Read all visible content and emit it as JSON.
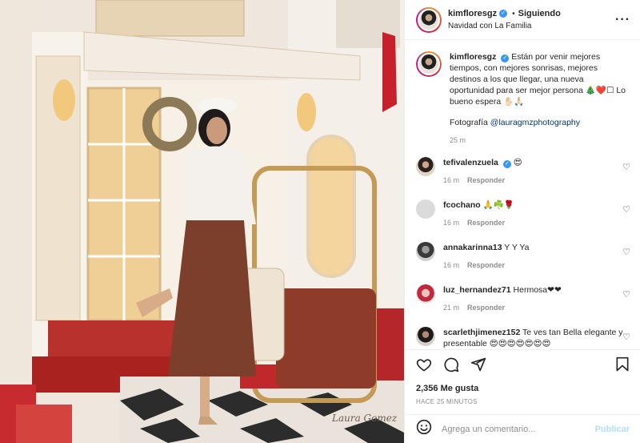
{
  "post": {
    "author": "kimfloresgz",
    "follow_state": "Siguiendo",
    "separator": "•",
    "location": "Navidad con La Familia",
    "more_icon": "more-horizontal-icon",
    "caption": "Están por venir mejores tiempos, con mejores sonrisas, mejores destinos a los que llegar, una nueva oportunidad para ser mejor persona 🎄❤️☐ Lo bueno espera ✋🏻🙏🏻",
    "credit_prefix": "Fotografía ",
    "credit_link": "@lauragmzphotography",
    "caption_time": "25 m",
    "likes": "2,356 Me gusta",
    "posted_ago": "HACE 25 MINUTOS"
  },
  "comments": [
    {
      "user": "tefivalenzuela",
      "verified": true,
      "text": "😍",
      "time": "16 m",
      "reply": "Responder"
    },
    {
      "user": "fcochano",
      "verified": false,
      "text": "🙏☘️🌹",
      "time": "16 m",
      "reply": "Responder"
    },
    {
      "user": "annakarinna13",
      "verified": false,
      "text": "Y Y Ya",
      "time": "16 m",
      "reply": "Responder"
    },
    {
      "user": "luz_hernandez71",
      "verified": false,
      "text": "Hermosa❤❤",
      "time": "21 m",
      "reply": "Responder"
    },
    {
      "user": "scarlethjimenez152",
      "verified": false,
      "text": "Te ves tan Bella elegante y presentable 😍😍😍😍😍😍😍",
      "time": "",
      "reply": ""
    }
  ],
  "composer": {
    "placeholder": "Agrega un comentario...",
    "publish": "Publicar"
  },
  "photo": {
    "watermark": "Laura Gomez"
  },
  "icons": [
    "heart-icon",
    "comment-icon",
    "share-icon",
    "bookmark-icon",
    "emoji-icon"
  ],
  "colors": {
    "link": "#00376b",
    "verified": "#3897f0",
    "publish": "#b2dffc",
    "muted": "#8e8e8e"
  }
}
